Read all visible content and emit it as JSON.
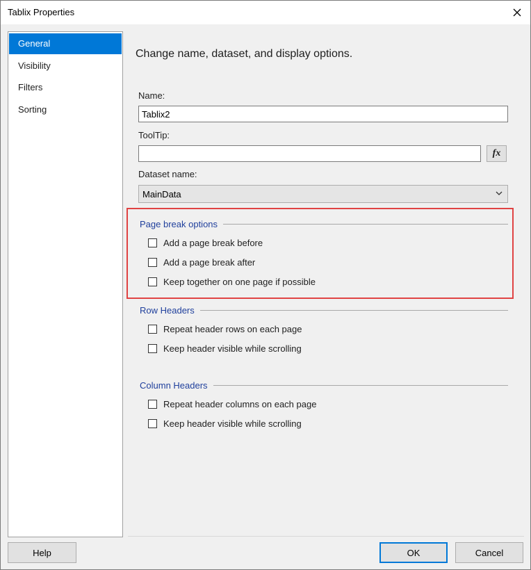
{
  "window": {
    "title": "Tablix Properties"
  },
  "nav": {
    "items": [
      {
        "label": "General",
        "selected": true
      },
      {
        "label": "Visibility",
        "selected": false
      },
      {
        "label": "Filters",
        "selected": false
      },
      {
        "label": "Sorting",
        "selected": false
      }
    ]
  },
  "main": {
    "heading": "Change name, dataset, and display options.",
    "name_label": "Name:",
    "name_value": "Tablix2",
    "tooltip_label": "ToolTip:",
    "tooltip_value": "",
    "fx_label": "fx",
    "dataset_label": "Dataset name:",
    "dataset_value": "MainData"
  },
  "page_break": {
    "title": "Page break options",
    "options": [
      {
        "label": "Add a page break before",
        "checked": false
      },
      {
        "label": "Add a page break after",
        "checked": false
      },
      {
        "label": "Keep together on one page if possible",
        "checked": false
      }
    ]
  },
  "row_headers": {
    "title": "Row Headers",
    "options": [
      {
        "label": "Repeat header rows on each page",
        "checked": false
      },
      {
        "label": "Keep header visible while scrolling",
        "checked": false
      }
    ]
  },
  "column_headers": {
    "title": "Column Headers",
    "options": [
      {
        "label": "Repeat header columns on each page",
        "checked": false
      },
      {
        "label": "Keep header visible while scrolling",
        "checked": false
      }
    ]
  },
  "footer": {
    "help": "Help",
    "ok": "OK",
    "cancel": "Cancel"
  },
  "colors": {
    "accent": "#0078d7",
    "highlight": "#e04343",
    "group_title": "#1f3f9c"
  }
}
